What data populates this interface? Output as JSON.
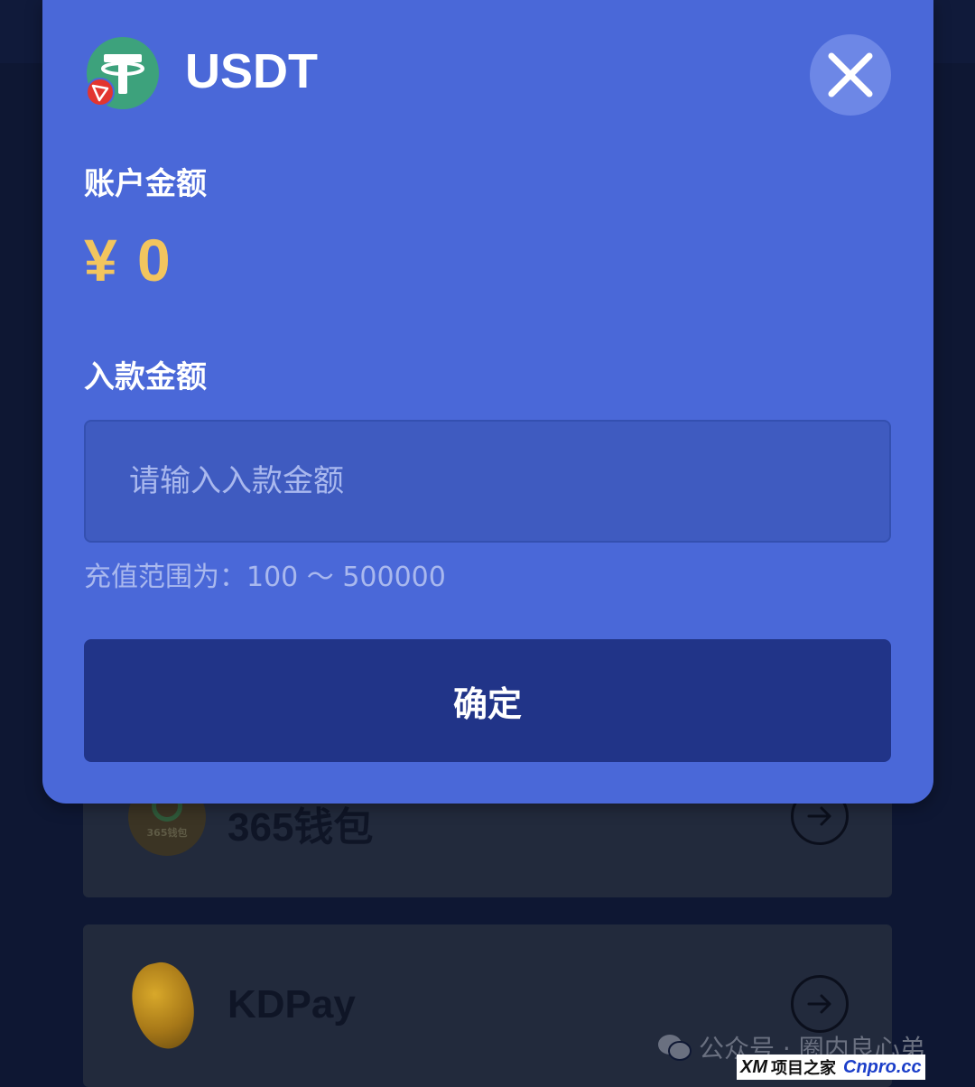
{
  "modal": {
    "title": "USDT",
    "balance_label": "账户金额",
    "balance_value": "¥ 0",
    "deposit_label": "入款金额",
    "input_placeholder": "请输入入款金额",
    "input_value": "",
    "range_hint": "充值范围为：100 ～ 500000",
    "confirm_label": "确定",
    "coin_icon": "usdt-tron-icon",
    "close_icon": "close-icon"
  },
  "wallets": [
    {
      "name": "365钱包",
      "logo_text": "365钱包",
      "icon": "arrow-right-icon"
    },
    {
      "name": "KDPay",
      "icon": "arrow-right-icon"
    }
  ],
  "watermark": {
    "text": "公众号 · 圈内良心弟",
    "logo_xm": "XM",
    "logo_zh": "项目之家",
    "logo_cn": "Cnpro.cc"
  },
  "colors": {
    "modal_bg": "#4a68d8",
    "confirm_bg": "#213488",
    "balance_color": "#f2c55e",
    "page_bg": "#0e1733"
  }
}
